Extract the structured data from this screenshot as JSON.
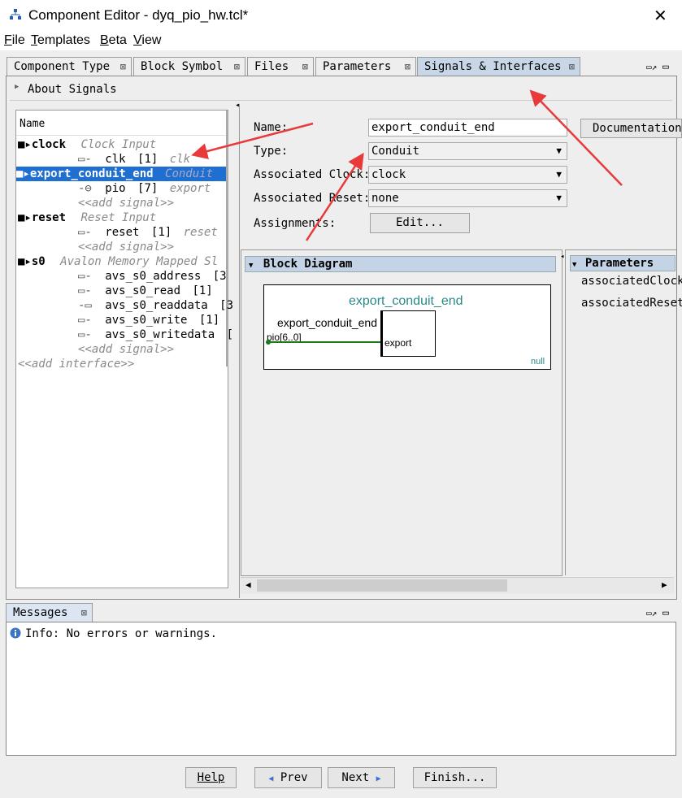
{
  "window": {
    "title": "Component Editor - dyq_pio_hw.tcl*",
    "close_glyph": "✕"
  },
  "menu": [
    {
      "first": "F",
      "rest": "ile"
    },
    {
      "first": "T",
      "rest": "emplates"
    },
    {
      "first": "B",
      "rest": "eta"
    },
    {
      "first": "V",
      "rest": "iew"
    }
  ],
  "tabs": [
    {
      "label": "Component Type",
      "active": false
    },
    {
      "label": "Block Symbol",
      "active": false
    },
    {
      "label": "Files",
      "active": false
    },
    {
      "label": "Parameters",
      "active": false
    },
    {
      "label": "Signals & Interfaces",
      "active": true
    }
  ],
  "about_signals": "About Signals",
  "tree": {
    "header": "Name",
    "add_interface": "<<add interface>>",
    "add_signal": "<<add signal>>",
    "interfaces": [
      {
        "name": "clock",
        "type": "Clock Input",
        "selected": false,
        "signals": [
          {
            "name": "clk",
            "width": "[1]",
            "role": "clk"
          }
        ]
      },
      {
        "name": "export_conduit_end",
        "type": "Conduit",
        "selected": true,
        "signals": [
          {
            "name": "pio",
            "width": "[7]",
            "role": "export"
          }
        ]
      },
      {
        "name": "reset",
        "type": "Reset Input",
        "selected": false,
        "signals": [
          {
            "name": "reset",
            "width": "[1]",
            "role": "reset"
          }
        ]
      },
      {
        "name": "s0",
        "type": "Avalon Memory Mapped Sl",
        "selected": false,
        "signals": [
          {
            "name": "avs_s0_address",
            "width": "[3",
            "role": ""
          },
          {
            "name": "avs_s0_read",
            "width": "[1]",
            "role": ""
          },
          {
            "name": "avs_s0_readdata",
            "width": "[3",
            "role": ""
          },
          {
            "name": "avs_s0_write",
            "width": "[1]",
            "role": ""
          },
          {
            "name": "avs_s0_writedata",
            "width": "[",
            "role": ""
          }
        ]
      }
    ]
  },
  "form": {
    "name_label": "Name:",
    "name_value": "export_conduit_end",
    "documentation_button": "Documentation",
    "type_label": "Type:",
    "type_value": "Conduit",
    "clock_label": "Associated Clock:",
    "clock_value": "clock",
    "reset_label": "Associated Reset:",
    "reset_value": "none",
    "assignments_label": "Assignments:",
    "edit_button": "Edit..."
  },
  "block_diagram": {
    "title": "Block Diagram",
    "component_name": "export_conduit_end",
    "interface_label": "export_conduit_end",
    "port_label": "pio[6..0]",
    "box_label": "export",
    "footer": "null",
    "line_color": "#1a7a1a",
    "title_color": "#2a8a8a"
  },
  "parameters": {
    "title": "Parameters",
    "items": [
      "associatedClock",
      "associatedReset"
    ]
  },
  "messages": {
    "tab": "Messages",
    "text": "Info: No errors or warnings."
  },
  "buttons": {
    "help": "Help",
    "prev": "Prev",
    "next": "Next",
    "finish": "Finish..."
  },
  "annotation_color": "#e83a3a"
}
